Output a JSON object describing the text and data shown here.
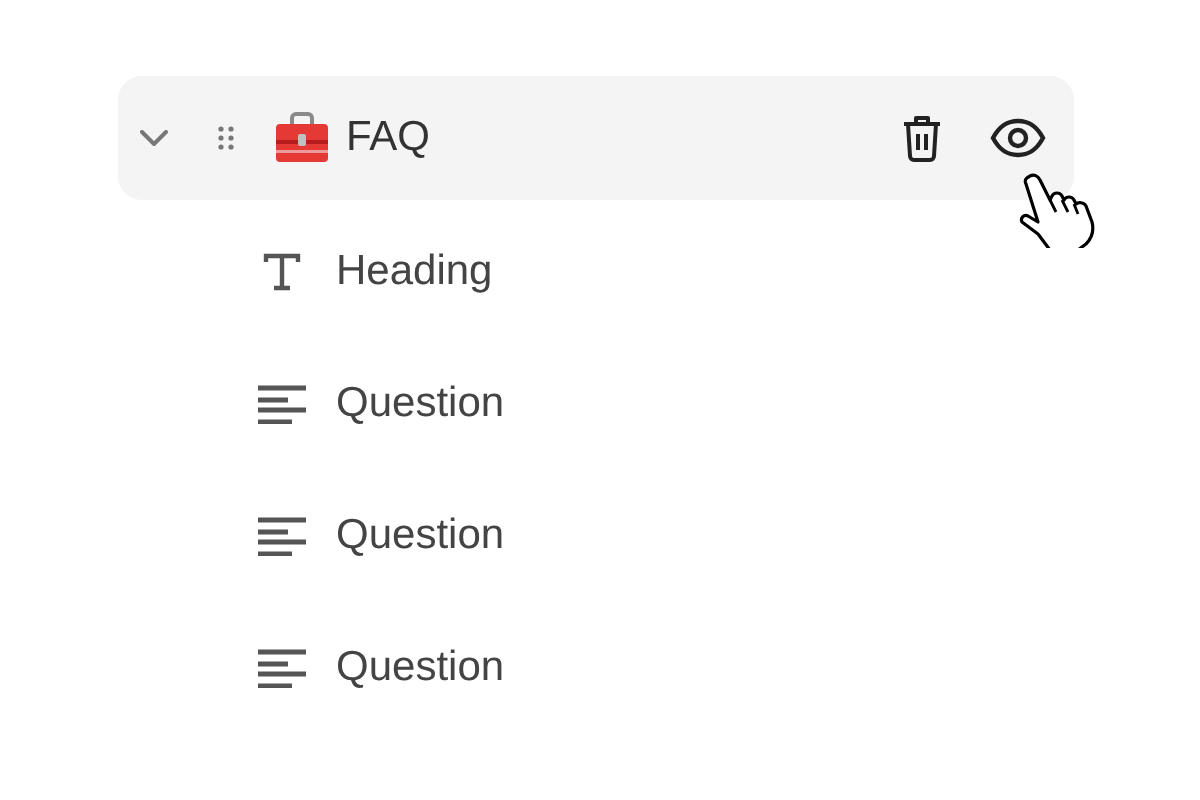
{
  "block": {
    "label": "FAQ",
    "expanded": true,
    "children": [
      {
        "kind": "heading",
        "label": "Heading"
      },
      {
        "kind": "text",
        "label": "Question"
      },
      {
        "kind": "text",
        "label": "Question"
      },
      {
        "kind": "text",
        "label": "Question"
      }
    ]
  }
}
